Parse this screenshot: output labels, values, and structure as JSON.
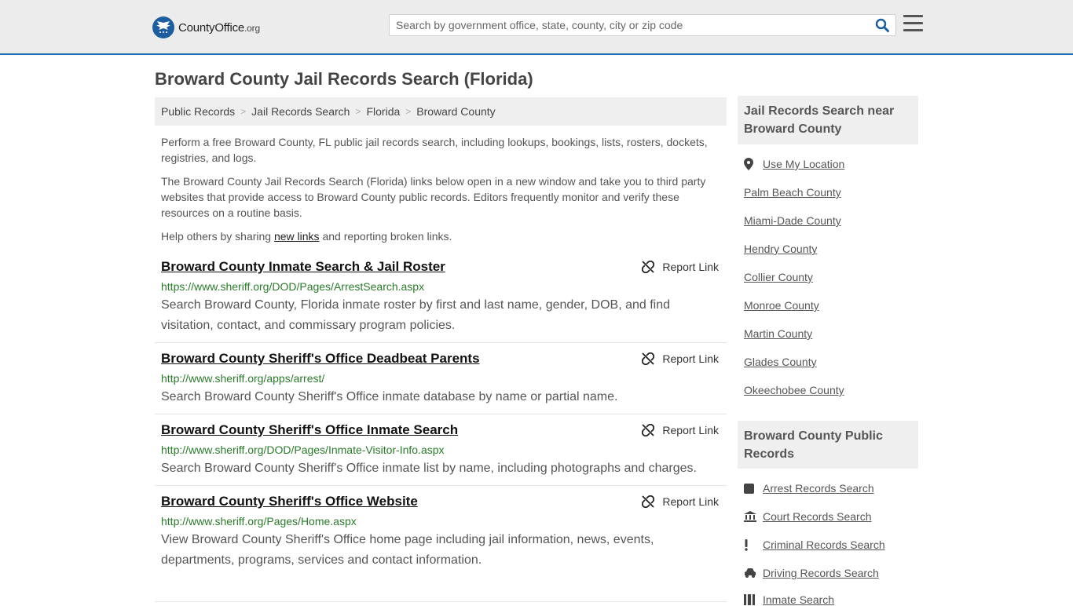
{
  "header": {
    "logo_main": "CountyOffice",
    "logo_suffix": ".org",
    "search_placeholder": "Search by government office, state, county, city or zip code"
  },
  "page_title": "Broward County Jail Records Search (Florida)",
  "breadcrumb": [
    "Public Records",
    "Jail Records Search",
    "Florida",
    "Broward County"
  ],
  "intro": {
    "p1": "Perform a free Broward County, FL public jail records search, including lookups, bookings, lists, rosters, dockets, registries, and logs.",
    "p2": "The Broward County Jail Records Search (Florida) links below open in a new window and take you to third party websites that provide access to Broward County public records. Editors frequently monitor and verify these resources on a routine basis.",
    "p3_pre": "Help others by sharing ",
    "p3_link": "new links",
    "p3_post": " and reporting broken links."
  },
  "report_label": "Report Link",
  "results": [
    {
      "title": "Broward County Inmate Search & Jail Roster",
      "url": "https://www.sheriff.org/DOD/Pages/ArrestSearch.aspx",
      "desc": "Search Broward County, Florida inmate roster by first and last name, gender, DOB, and find visitation, contact, and commissary program policies."
    },
    {
      "title": "Broward County Sheriff's Office Deadbeat Parents",
      "url": "http://www.sheriff.org/apps/arrest/",
      "desc": "Search Broward County Sheriff's Office inmate database by name or partial name."
    },
    {
      "title": "Broward County Sheriff's Office Inmate Search",
      "url": "http://www.sheriff.org/DOD/Pages/Inmate-Visitor-Info.aspx",
      "desc": "Search Broward County Sheriff's Office inmate list by name, including photographs and charges."
    },
    {
      "title": "Broward County Sheriff's Office Website",
      "url": "http://www.sheriff.org/Pages/Home.aspx",
      "desc": "View Broward County Sheriff's Office home page including jail information, news, events, departments, programs, services and contact information."
    }
  ],
  "sidebar": {
    "nearby_heading": "Jail Records Search near Broward County",
    "use_location": "Use My Location",
    "nearby": [
      "Palm Beach County",
      "Miami-Dade County",
      "Hendry County",
      "Collier County",
      "Monroe County",
      "Martin County",
      "Glades County",
      "Okeechobee County"
    ],
    "public_heading": "Broward County Public Records",
    "public_links": [
      {
        "label": "Arrest Records Search",
        "icon": "square-icon"
      },
      {
        "label": "Court Records Search",
        "icon": "courthouse-icon"
      },
      {
        "label": "Criminal Records Search",
        "icon": "exclamation-icon"
      },
      {
        "label": "Driving Records Search",
        "icon": "car-icon"
      },
      {
        "label": "Inmate Search",
        "icon": "inmate-icon"
      }
    ]
  },
  "colors": {
    "header_bg": "#ececec",
    "header_border": "#1f6fb2",
    "url_green": "#2b7a2b",
    "brand_blue": "#1f5e9e"
  }
}
